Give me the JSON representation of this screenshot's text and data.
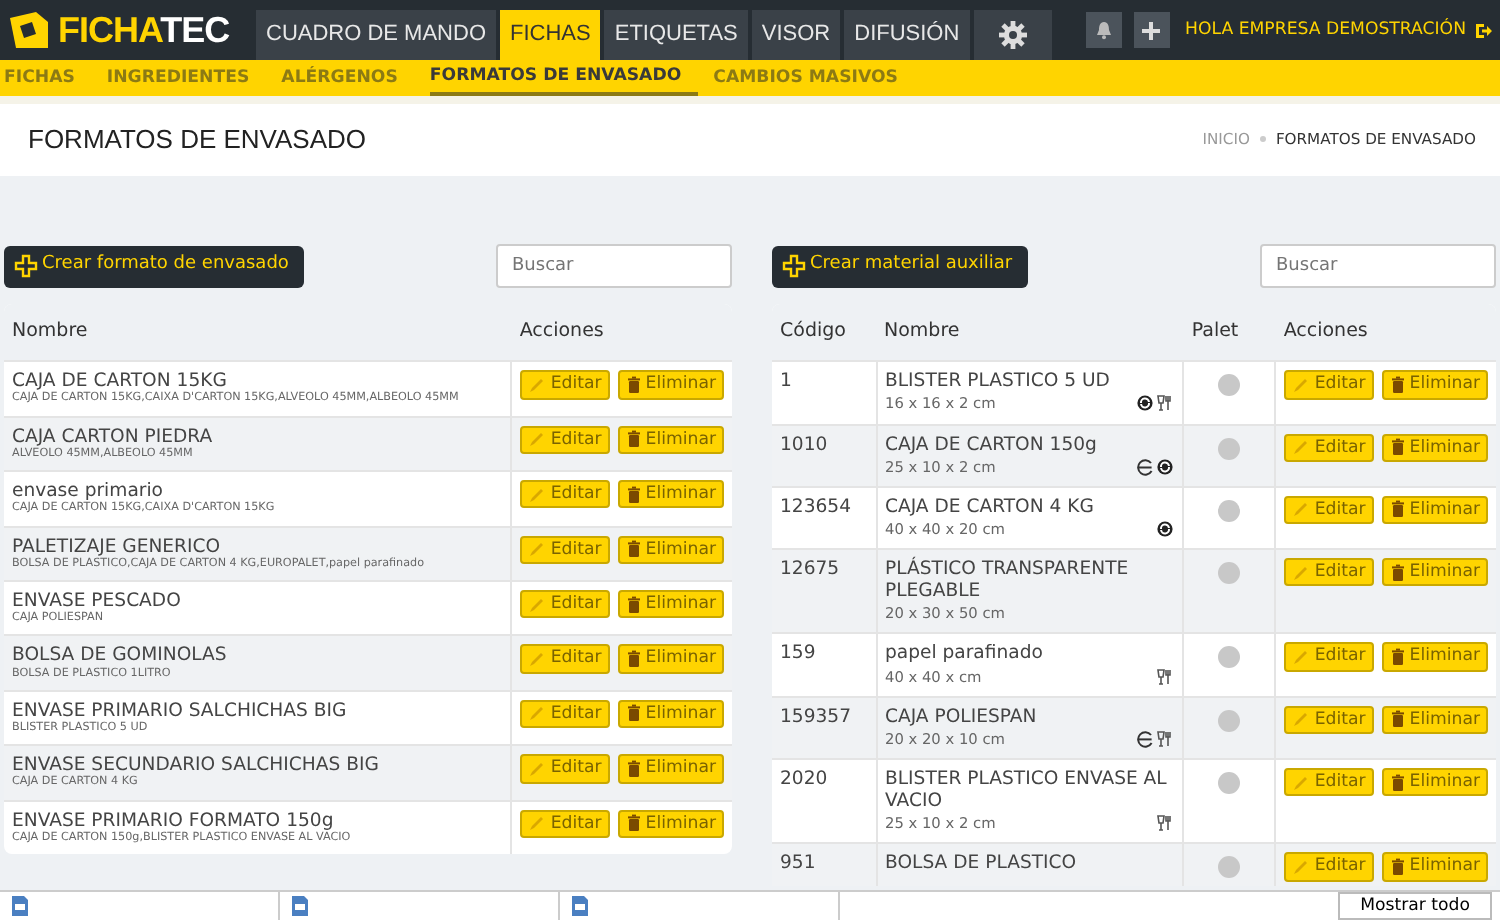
{
  "logo": {
    "left": "FICHA",
    "right": "TEC"
  },
  "nav_tabs": [
    {
      "label": "CUADRO DE MANDO",
      "selected": false
    },
    {
      "label": "FICHAS",
      "selected": true
    },
    {
      "label": "ETIQUETAS",
      "selected": false
    },
    {
      "label": "VISOR",
      "selected": false
    },
    {
      "label": "DIFUSIÓN",
      "selected": false
    },
    {
      "kind": "settings",
      "selected": false
    }
  ],
  "user": "HOLA EMPRESA DEMOSTRACIÓN",
  "sub_tabs": [
    {
      "label": "FICHAS",
      "selected": false
    },
    {
      "label": "INGREDIENTES",
      "selected": false
    },
    {
      "label": "ALÉRGENOS",
      "selected": false
    },
    {
      "label": "FORMATOS DE ENVASADO",
      "selected": true
    },
    {
      "label": "CAMBIOS MASIVOS",
      "selected": false
    }
  ],
  "page_title": "FORMATOS DE ENVASADO",
  "breadcrumb": [
    {
      "label": "INICIO",
      "selected": false
    },
    {
      "label": "FORMATOS DE ENVASADO",
      "selected": true
    }
  ],
  "formats": {
    "create_button": "Crear formato de envasado",
    "search": {
      "placeholder": "Buscar"
    },
    "columns": [
      "Nombre",
      "Acciones"
    ],
    "rows": [
      {
        "name": "CAJA DE CARTON 15KG",
        "materials": "CAJA DE CARTON 15KG,CAIXA D'CARTON 15KG,ALVEOLO 45MM,ALBEOLO 45MM",
        "edit": "Editar",
        "delete": "Eliminar"
      },
      {
        "name": "CAJA CARTON PIEDRA",
        "materials": "ALVEOLO 45MM,ALBEOLO 45MM",
        "edit": "Editar",
        "delete": "Eliminar"
      },
      {
        "name": "envase primario",
        "materials": "CAJA DE CARTON 15KG,CAIXA D'CARTON 15KG",
        "edit": "Editar",
        "delete": "Eliminar"
      },
      {
        "name": "PALETIZAJE GENERICO",
        "materials": "BOLSA DE PLASTICO,CAJA DE CARTON 4 KG,EUROPALET,papel parafinado",
        "edit": "Editar",
        "delete": "Eliminar"
      },
      {
        "name": "ENVASE PESCADO",
        "materials": "CAJA POLIESPAN",
        "edit": "Editar",
        "delete": "Eliminar"
      },
      {
        "name": "BOLSA DE GOMINOLAS",
        "materials": "BOLSA DE PLASTICO 1LITRO",
        "edit": "Editar",
        "delete": "Eliminar"
      },
      {
        "name": "ENVASE PRIMARIO SALCHICHAS BIG",
        "materials": "BLISTER PLASTICO 5 UD",
        "edit": "Editar",
        "delete": "Eliminar"
      },
      {
        "name": "ENVASE SECUNDARIO SALCHICHAS BIG",
        "materials": "CAJA DE CARTON 4 KG",
        "edit": "Editar",
        "delete": "Eliminar"
      },
      {
        "name": "ENVASE PRIMARIO FORMATO 150g",
        "materials": "CAJA DE CARTON 150g,BLISTER PLASTICO ENVASE AL VACIO",
        "edit": "Editar",
        "delete": "Eliminar"
      }
    ]
  },
  "materials": {
    "create_button": "Crear material auxiliar",
    "search": {
      "placeholder": "Buscar"
    },
    "columns": [
      "Código",
      "Nombre",
      "Palet",
      "Acciones"
    ],
    "rows": [
      {
        "code": "1",
        "name": "BLISTER PLASTICO 5 UD",
        "size": "16 x 16 x 2 cm",
        "estimated": false,
        "recyclable": true,
        "food_contact": true,
        "palet": false,
        "edit": "Editar",
        "delete": "Eliminar"
      },
      {
        "code": "1010",
        "name": "CAJA DE CARTON 150g",
        "size": "25 x 10 x 2 cm",
        "estimated": true,
        "recyclable": true,
        "food_contact": false,
        "palet": false,
        "edit": "Editar",
        "delete": "Eliminar"
      },
      {
        "code": "123654",
        "name": "CAJA DE CARTON 4 KG",
        "size": "40 x 40 x 20 cm",
        "estimated": false,
        "recyclable": true,
        "food_contact": false,
        "palet": false,
        "edit": "Editar",
        "delete": "Eliminar"
      },
      {
        "code": "12675",
        "name": "PLÁSTICO TRANSPARENTE PLEGABLE",
        "size": "20 x 30 x 50 cm",
        "estimated": false,
        "recyclable": false,
        "food_contact": false,
        "palet": false,
        "edit": "Editar",
        "delete": "Eliminar"
      },
      {
        "code": "159",
        "name": "papel parafinado",
        "size": "40 x 40 x cm",
        "estimated": false,
        "recyclable": false,
        "food_contact": true,
        "palet": false,
        "edit": "Editar",
        "delete": "Eliminar"
      },
      {
        "code": "159357",
        "name": "CAJA POLIESPAN",
        "size": "20 x 20 x 10 cm",
        "estimated": true,
        "recyclable": false,
        "food_contact": true,
        "palet": false,
        "edit": "Editar",
        "delete": "Eliminar"
      },
      {
        "code": "2020",
        "name": "BLISTER PLASTICO ENVASE AL VACIO",
        "size": "25 x 10 x 2 cm",
        "estimated": false,
        "recyclable": false,
        "food_contact": true,
        "palet": false,
        "edit": "Editar",
        "delete": "Eliminar"
      },
      {
        "code": "951",
        "name": "BOLSA DE PLASTICO",
        "palet": false,
        "edit": "Editar",
        "delete": "Eliminar"
      }
    ]
  },
  "download_bar": {
    "show_all": "Mostrar todo"
  }
}
